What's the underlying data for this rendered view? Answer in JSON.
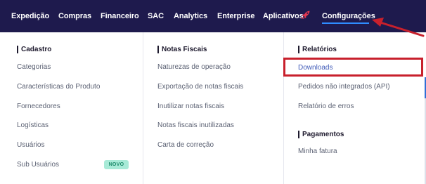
{
  "nav": {
    "items": [
      {
        "label": "Expedição"
      },
      {
        "label": "Compras"
      },
      {
        "label": "Financeiro"
      },
      {
        "label": "SAC"
      },
      {
        "label": "Analytics"
      },
      {
        "label": "Enterprise"
      },
      {
        "label": "Aplicativos"
      },
      {
        "label": "Configurações"
      }
    ],
    "active_item": "Configurações"
  },
  "menu": {
    "cadastro": {
      "title": "Cadastro",
      "items": [
        "Categorias",
        "Características do Produto",
        "Fornecedores",
        "Logísticas",
        "Usuários",
        "Sub Usuários"
      ],
      "badge": "NOVO"
    },
    "notas_fiscais": {
      "title": "Notas Fiscais",
      "items": [
        "Naturezas de operação",
        "Exportação de notas fiscais",
        "Inutilizar notas fiscais",
        "Notas fiscais inutilizadas",
        "Carta de correção"
      ]
    },
    "relatorios": {
      "title": "Relatórios",
      "items": [
        "Downloads",
        "Pedidos não integrados (API)",
        "Relatório de erros"
      ]
    },
    "pagamentos": {
      "title": "Pagamentos",
      "items": [
        "Minha fatura"
      ]
    }
  },
  "icons": {
    "rocket": "rocket-icon",
    "arrow": "arrow-annotation"
  },
  "colors": {
    "nav_bg": "#1e1a4d",
    "active_underline": "#2f8cff",
    "rocket": "#e8384f",
    "annotation": "#c8202c",
    "badge_bg": "#a8ead7",
    "badge_text": "#1d8a6a"
  }
}
